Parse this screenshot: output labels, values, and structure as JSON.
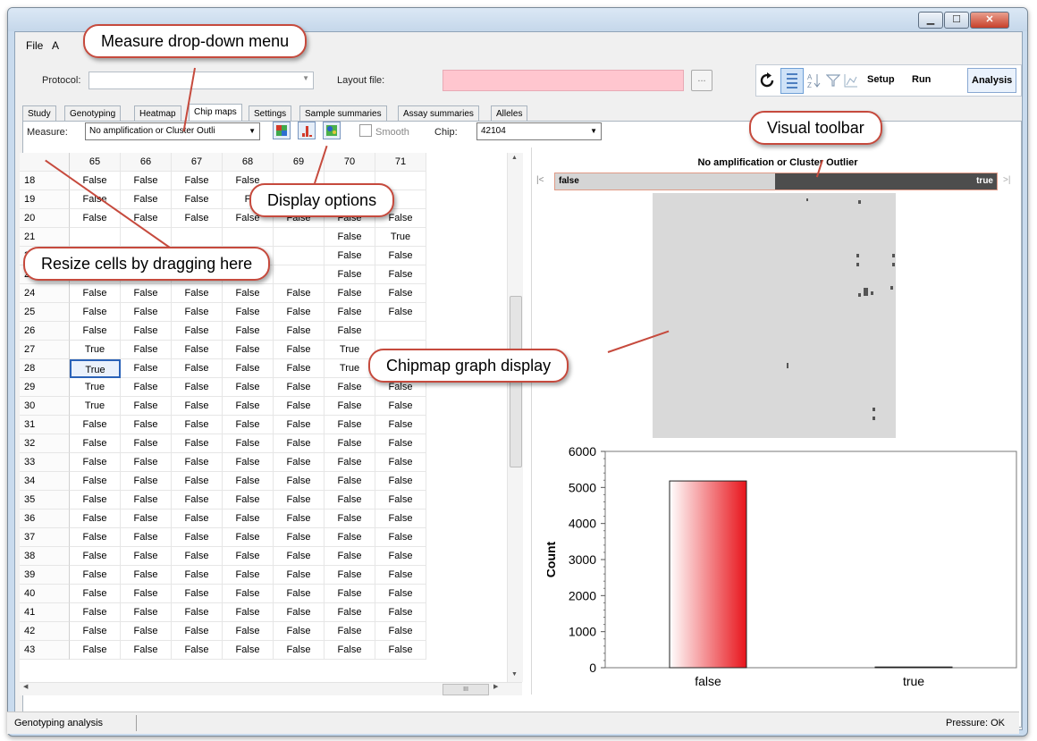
{
  "window": {
    "min": "▁",
    "max": "☐",
    "close": "✕"
  },
  "menu": [
    "File",
    "A"
  ],
  "protocol": {
    "label": "Protocol:",
    "value": ""
  },
  "layout": {
    "label": "Layout file:",
    "value": ""
  },
  "toolbar": {
    "setup": "Setup",
    "run": "Run",
    "analysis": "Analysis",
    "browse": "..."
  },
  "tabs": [
    "Study",
    "Genotyping",
    "Heatmap",
    "Chip maps",
    "Settings",
    "Sample summaries",
    "Assay summaries",
    "Alleles"
  ],
  "active_tab": 3,
  "measure": {
    "label": "Measure:",
    "value": "No amplification or Cluster Outli",
    "smooth": "Smooth",
    "chip_label": "Chip:",
    "chip_value": "42104"
  },
  "grid": {
    "columns": [
      "65",
      "66",
      "67",
      "68",
      "69",
      "70",
      "71"
    ],
    "rows": [
      {
        "n": "18",
        "c": [
          "False",
          "False",
          "False",
          "False",
          "",
          "",
          ""
        ]
      },
      {
        "n": "19",
        "c": [
          "False",
          "False",
          "False",
          "F",
          "",
          "",
          ""
        ]
      },
      {
        "n": "20",
        "c": [
          "False",
          "False",
          "False",
          "False",
          "False",
          "False",
          "False"
        ]
      },
      {
        "n": "21",
        "c": [
          "",
          "",
          "",
          "",
          "",
          "False",
          "True"
        ]
      },
      {
        "n": "22",
        "c": [
          "",
          "",
          "",
          "",
          "",
          "False",
          "False"
        ]
      },
      {
        "n": "23",
        "c": [
          "",
          "",
          "",
          "",
          "",
          "False",
          "False"
        ]
      },
      {
        "n": "24",
        "c": [
          "False",
          "False",
          "False",
          "False",
          "False",
          "False",
          "False"
        ]
      },
      {
        "n": "25",
        "c": [
          "False",
          "False",
          "False",
          "False",
          "False",
          "False",
          "False"
        ]
      },
      {
        "n": "26",
        "c": [
          "False",
          "False",
          "False",
          "False",
          "False",
          "False",
          ""
        ]
      },
      {
        "n": "27",
        "c": [
          "True",
          "False",
          "False",
          "False",
          "False",
          "True",
          ""
        ]
      },
      {
        "n": "28",
        "c": [
          "True",
          "False",
          "False",
          "False",
          "False",
          "True",
          "False"
        ]
      },
      {
        "n": "29",
        "c": [
          "True",
          "False",
          "False",
          "False",
          "False",
          "False",
          "False"
        ]
      },
      {
        "n": "30",
        "c": [
          "True",
          "False",
          "False",
          "False",
          "False",
          "False",
          "False"
        ]
      },
      {
        "n": "31",
        "c": [
          "False",
          "False",
          "False",
          "False",
          "False",
          "False",
          "False"
        ]
      },
      {
        "n": "32",
        "c": [
          "False",
          "False",
          "False",
          "False",
          "False",
          "False",
          "False"
        ]
      },
      {
        "n": "33",
        "c": [
          "False",
          "False",
          "False",
          "False",
          "False",
          "False",
          "False"
        ]
      },
      {
        "n": "34",
        "c": [
          "False",
          "False",
          "False",
          "False",
          "False",
          "False",
          "False"
        ]
      },
      {
        "n": "35",
        "c": [
          "False",
          "False",
          "False",
          "False",
          "False",
          "False",
          "False"
        ]
      },
      {
        "n": "36",
        "c": [
          "False",
          "False",
          "False",
          "False",
          "False",
          "False",
          "False"
        ]
      },
      {
        "n": "37",
        "c": [
          "False",
          "False",
          "False",
          "False",
          "False",
          "False",
          "False"
        ]
      },
      {
        "n": "38",
        "c": [
          "False",
          "False",
          "False",
          "False",
          "False",
          "False",
          "False"
        ]
      },
      {
        "n": "39",
        "c": [
          "False",
          "False",
          "False",
          "False",
          "False",
          "False",
          "False"
        ]
      },
      {
        "n": "40",
        "c": [
          "False",
          "False",
          "False",
          "False",
          "False",
          "False",
          "False"
        ]
      },
      {
        "n": "41",
        "c": [
          "False",
          "False",
          "False",
          "False",
          "False",
          "False",
          "False"
        ]
      },
      {
        "n": "42",
        "c": [
          "False",
          "False",
          "False",
          "False",
          "False",
          "False",
          "False"
        ]
      },
      {
        "n": "43",
        "c": [
          "False",
          "False",
          "False",
          "False",
          "False",
          "False",
          "False"
        ]
      }
    ],
    "selected": {
      "row": 10,
      "col": 0
    },
    "hscroll_grip": "III"
  },
  "chipmap": {
    "title": "No amplification or Cluster Outlier",
    "bar_left": "false",
    "bar_right": "true",
    "nav_first": "|<",
    "nav_last": ">|"
  },
  "chart_data": {
    "type": "bar",
    "categories": [
      "false",
      "true"
    ],
    "values": [
      5180,
      20
    ],
    "title": "",
    "xlabel": "",
    "ylabel": "Count",
    "ylim": [
      0,
      6000
    ],
    "yticks": [
      0,
      1000,
      2000,
      3000,
      4000,
      5000,
      6000
    ],
    "colors": {
      "bar": "#e8141b",
      "bar_light": "#ffffff",
      "true_bar": "#333333"
    }
  },
  "callouts": {
    "measure": "Measure drop-down menu",
    "visual_toolbar": "Visual toolbar",
    "display_options": "Display options",
    "resize": "Resize cells by dragging here",
    "chipmap": "Chipmap graph display"
  },
  "status": {
    "left": "Genotyping analysis",
    "right": "Pressure: OK"
  },
  "colors": {
    "layout_field": "#ffc6cf",
    "callout_border": "#c64a3d",
    "window_frame": "#c9dbee"
  }
}
